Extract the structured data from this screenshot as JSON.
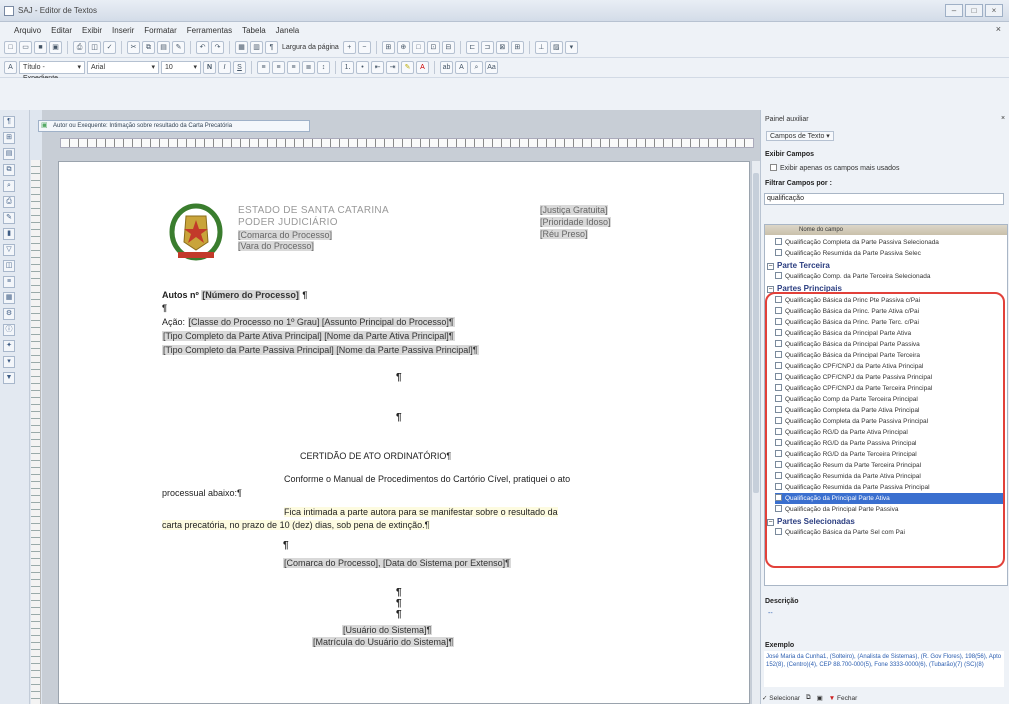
{
  "window": {
    "title": "SAJ - Editor de Textos",
    "close_doc": "×"
  },
  "menu": [
    "Arquivo",
    "Editar",
    "Exibir",
    "Inserir",
    "Formatar",
    "Ferramentas",
    "Tabela",
    "Janela"
  ],
  "toolbar": {
    "ruler_label": "Largura da página",
    "style_combo": "Título - Expediente",
    "font_combo": "Arial",
    "size_combo": "10"
  },
  "document_tab": "Autor ou Exequente: Intimação sobre resultado da Carta Precatória",
  "doc_header": {
    "state": "ESTADO DE SANTA CATARINA",
    "power": "PODER JUDICIÁRIO",
    "comarca": "[Comarca do Processo]",
    "vara": "[Vara do Processo]",
    "justica": "[Justiça Gratuita]",
    "prioridade": "[Prioridade Idoso]",
    "reu_preso": "[Réu Preso]"
  },
  "doc_body": {
    "autos_prefix": "Autos nº ",
    "autos_field": "[Número do Processo]",
    "pilcrow": "¶",
    "acao_prefix": "Ação: ",
    "acao_line": "[Classe do Processo no 1º Grau] [Assunto Principal do Processo]¶",
    "line3": "[Tipo Completo da Parte Ativa Principal] [Nome da Parte Ativa Principal]¶",
    "line4": "[Tipo Completo da Parte Passiva Principal] [Nome da Parte Passiva Principal]¶",
    "certidao": "CERTIDÃO DE ATO ORDINATÓRIO¶",
    "par1_a": "Conforme o Manual de Procedimentos do Cartório Cível, pratiquei o ato",
    "par1_b": "processual abaixo:¶",
    "par2_a": "Fica intimada a parte autora para se manifestar sobre o resultado da",
    "par2_b": "carta precatória, no prazo de 10 (dez) dias, sob pena de extinção.¶",
    "comarca_data": "[Comarca do Processo], [Data do Sistema por Extenso]¶",
    "usuario": "[Usuário do Sistema]¶",
    "matricula": "[Matrícula do Usuário do Sistema]¶"
  },
  "panel": {
    "title": "Painel auxiliar",
    "campos_btn": "Campos de Texto ▾",
    "exibir_campos": "Exibir Campos",
    "exibir_apenas": "Exibir apenas os campos mais usados",
    "filtrar": "Filtrar Campos por :",
    "filter_value": "qualificação",
    "col_header": "Nome do campo",
    "items_top": [
      "Qualificação Completa da Parte Passiva Selecionada",
      "Qualificação Resumida da Parte Passiva Selec"
    ],
    "group_terceira": "Parte Terceira",
    "item_terceira": "Qualificação Comp. da Parte Terceira Selecionada",
    "group_principais": "Partes Principais",
    "items_principais": [
      "Qualificação Básica da Princ Pte Passiva c/Pai",
      "Qualificação Básica da Princ. Parte Ativa c/Pai",
      "Qualificação Básica da Princ. Parte Terc. c/Pai",
      "Qualificação Básica da Principal Parte Ativa",
      "Qualificação Básica da Principal Parte Passiva",
      "Qualificação Básica da Principal Parte Terceira",
      "Qualificação CPF/CNPJ da Parte Ativa Principal",
      "Qualificação CPF/CNPJ da Parte Passiva Principal",
      "Qualificação CPF/CNPJ da Parte Terceira Principal",
      "Qualificação Comp da Parte Terceira Principal",
      "Qualificação Completa da Parte Ativa Principal",
      "Qualificação Completa da Parte Passiva Principal",
      "Qualificação RG/D da Parte Ativa Principal",
      "Qualificação RG/D da Parte Passiva Principal",
      "Qualificação RG/D da Parte Terceira Principal",
      "Qualificação Resum da Parte Terceira Principal",
      "Qualificação Resumida da Parte Ativa Principal",
      "Qualificação Resumida da Parte Passiva Principal",
      "Qualificação da Principal Parte Ativa",
      "Qualificação da Principal Parte Passiva"
    ],
    "group_selecionadas": "Partes Selecionadas",
    "item_selecionadas": "Qualificação Básica da Parte Sel com Pai",
    "descricao": "Descrição",
    "descricao_value": "--",
    "exemplo": "Exemplo",
    "exemplo_text": "José Maria da Cunha1, (Solteiro), (Analista de Sistemas), (R. Gov Flores), 198(56), Apto 152(8), (Centro)(4), CEP 88.700-000(5), Fone 3333-0000(6), (Tubarão)(7) (SC)(8)",
    "selecionar": "Selecionar",
    "fechar": "Fechar"
  }
}
